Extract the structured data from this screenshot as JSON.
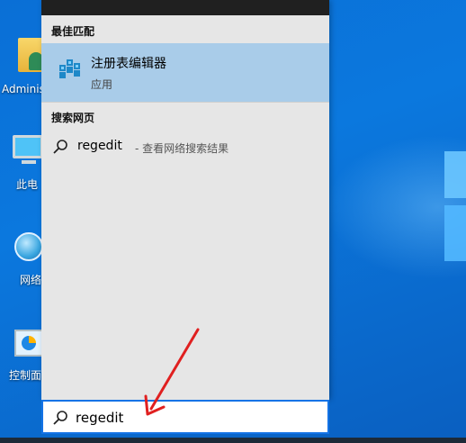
{
  "desktop": {
    "icons": [
      {
        "label": "Adminis",
        "icon": "user-folder-icon"
      },
      {
        "label": "此电",
        "icon": "computer-icon"
      },
      {
        "label": "网络",
        "icon": "network-icon"
      },
      {
        "label": "控制面",
        "icon": "control-panel-icon"
      }
    ]
  },
  "start_search": {
    "best_match_title": "最佳匹配",
    "best_match": {
      "name": "注册表编辑器",
      "type": "应用",
      "icon": "registry-editor-icon"
    },
    "web_title": "搜索网页",
    "web_result": {
      "term": "regedit",
      "description": "- 查看网络搜索结果",
      "icon": "search-icon"
    },
    "search_box": {
      "value": "regedit",
      "icon": "search-icon"
    }
  },
  "colors": {
    "highlight": "#a9cce9",
    "panel_bg": "#e6e6e6",
    "search_border": "#1473e6",
    "annotation_arrow": "#e02020"
  }
}
